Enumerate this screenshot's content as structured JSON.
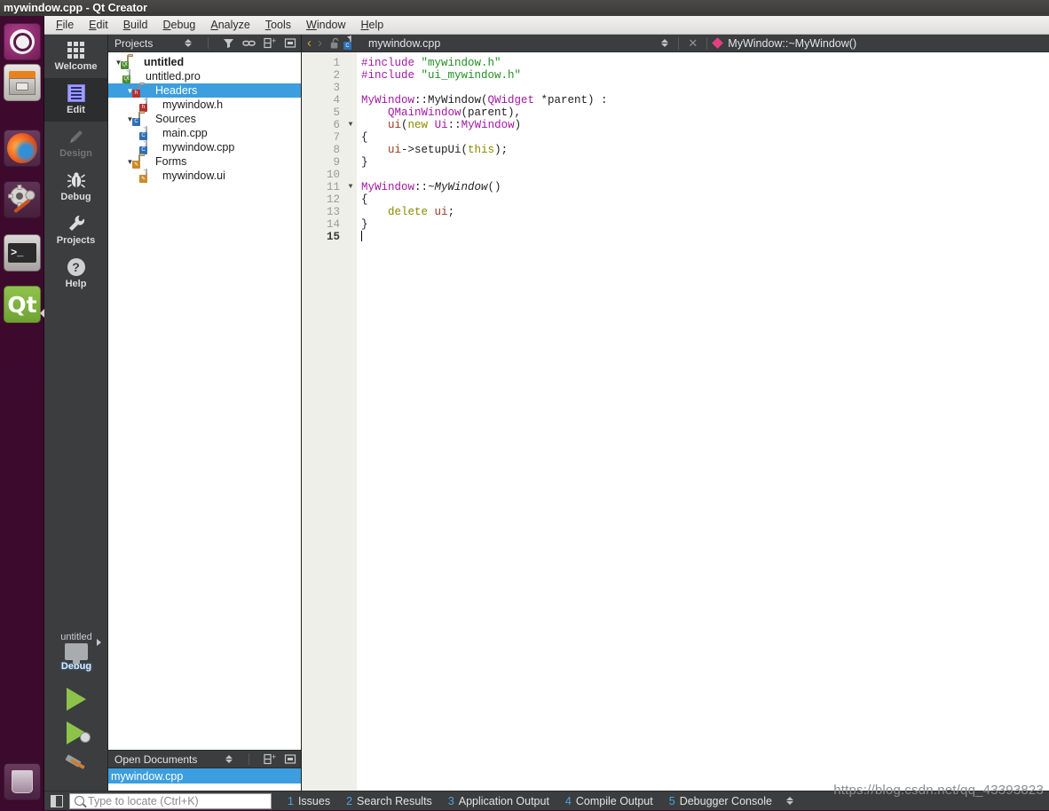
{
  "window": {
    "title": "mywindow.cpp - Qt Creator"
  },
  "menubar": {
    "items": [
      "File",
      "Edit",
      "Build",
      "Debug",
      "Analyze",
      "Tools",
      "Window",
      "Help"
    ]
  },
  "launcher": {
    "items": [
      {
        "name": "ubuntu-dash-icon",
        "label": "Ubuntu"
      },
      {
        "name": "files-icon",
        "label": "Files"
      },
      {
        "name": "firefox-icon",
        "label": "Firefox"
      },
      {
        "name": "settings-icon",
        "label": "System Settings"
      },
      {
        "name": "terminal-icon",
        "label": "Terminal"
      },
      {
        "name": "qt-creator-icon",
        "label": "Qt"
      },
      {
        "name": "trash-icon",
        "label": "Trash"
      }
    ],
    "qt_badge": "Qt",
    "terminal_prompt": ">_"
  },
  "modebar": {
    "modes": [
      {
        "label": "Welcome",
        "icon": "grid-icon",
        "state": "normal"
      },
      {
        "label": "Edit",
        "icon": "document-lines-icon",
        "state": "active"
      },
      {
        "label": "Design",
        "icon": "pencil-icon",
        "state": "disabled"
      },
      {
        "label": "Debug",
        "icon": "bug-icon",
        "state": "normal"
      },
      {
        "label": "Projects",
        "icon": "wrench-icon",
        "state": "normal"
      },
      {
        "label": "Help",
        "icon": "question-circle-icon",
        "state": "normal"
      }
    ],
    "kit": {
      "project": "untitled",
      "configuration": "Debug"
    },
    "actions": [
      {
        "name": "run-button",
        "label": "Run"
      },
      {
        "name": "start-debugging-button",
        "label": "Start Debugging"
      },
      {
        "name": "build-button",
        "label": "Build"
      }
    ]
  },
  "projects_dock": {
    "title": "Projects",
    "toolbar": [
      "view-selector-icon",
      "filter-icon",
      "sync-link-icon",
      "split-add-icon",
      "collapse-icon"
    ],
    "tree": [
      {
        "indent": 0,
        "arrow": "down",
        "icon": "qt-project-folder-icon",
        "label": "untitled",
        "bold": true,
        "selected": false
      },
      {
        "indent": 1,
        "arrow": "none",
        "icon": "qt-pro-file-icon",
        "label": "untitled.pro",
        "bold": false,
        "selected": false
      },
      {
        "indent": 1,
        "arrow": "down",
        "icon": "headers-folder-icon",
        "label": "Headers",
        "bold": false,
        "selected": true
      },
      {
        "indent": 2,
        "arrow": "none",
        "icon": "h-file-icon",
        "label": "mywindow.h",
        "bold": false,
        "selected": false
      },
      {
        "indent": 1,
        "arrow": "down",
        "icon": "sources-folder-icon",
        "label": "Sources",
        "bold": false,
        "selected": false
      },
      {
        "indent": 2,
        "arrow": "none",
        "icon": "cpp-file-icon",
        "label": "main.cpp",
        "bold": false,
        "selected": false
      },
      {
        "indent": 2,
        "arrow": "none",
        "icon": "cpp-file-icon",
        "label": "mywindow.cpp",
        "bold": false,
        "selected": false
      },
      {
        "indent": 1,
        "arrow": "down",
        "icon": "forms-folder-icon",
        "label": "Forms",
        "bold": false,
        "selected": false
      },
      {
        "indent": 2,
        "arrow": "none",
        "icon": "ui-file-icon",
        "label": "mywindow.ui",
        "bold": false,
        "selected": false
      }
    ]
  },
  "open_documents_dock": {
    "title": "Open Documents",
    "toolbar": [
      "view-selector-icon",
      "split-add-icon",
      "collapse-icon"
    ],
    "documents": [
      {
        "label": "mywindow.cpp",
        "selected": true
      }
    ]
  },
  "editor_toolbar": {
    "back_label": "‹",
    "forward_label": "›",
    "lock_state": "unlocked",
    "file_name": "mywindow.cpp",
    "close_label": "✕",
    "symbol": "MyWindow::~MyWindow()"
  },
  "editor": {
    "line_numbers": [
      "1",
      "2",
      "3",
      "4",
      "5",
      "6",
      "7",
      "8",
      "9",
      "10",
      "11",
      "12",
      "13",
      "14",
      "15"
    ],
    "current_line": 15,
    "fold_markers": {
      "6": "down",
      "11": "down"
    },
    "lines": [
      {
        "n": 1,
        "tokens": [
          {
            "t": "#include ",
            "c": "pre"
          },
          {
            "t": "\"mywindow.h\"",
            "c": "str"
          }
        ]
      },
      {
        "n": 2,
        "tokens": [
          {
            "t": "#include ",
            "c": "pre"
          },
          {
            "t": "\"ui_mywindow.h\"",
            "c": "str"
          }
        ]
      },
      {
        "n": 3,
        "tokens": []
      },
      {
        "n": 4,
        "tokens": [
          {
            "t": "MyWindow",
            "c": "type"
          },
          {
            "t": "::MyWindow(",
            "c": "plain"
          },
          {
            "t": "QWidget",
            "c": "type"
          },
          {
            "t": " *parent) :",
            "c": "plain"
          }
        ]
      },
      {
        "n": 5,
        "tokens": [
          {
            "t": "    ",
            "c": "plain"
          },
          {
            "t": "QMainWindow",
            "c": "type"
          },
          {
            "t": "(parent),",
            "c": "plain"
          }
        ]
      },
      {
        "n": 6,
        "tokens": [
          {
            "t": "    ",
            "c": "plain"
          },
          {
            "t": "ui",
            "c": "fld"
          },
          {
            "t": "(",
            "c": "plain"
          },
          {
            "t": "new",
            "c": "kw"
          },
          {
            "t": " ",
            "c": "plain"
          },
          {
            "t": "Ui",
            "c": "type"
          },
          {
            "t": "::",
            "c": "plain"
          },
          {
            "t": "MyWindow",
            "c": "type"
          },
          {
            "t": ")",
            "c": "plain"
          }
        ]
      },
      {
        "n": 7,
        "tokens": [
          {
            "t": "{",
            "c": "plain"
          }
        ]
      },
      {
        "n": 8,
        "tokens": [
          {
            "t": "    ",
            "c": "plain"
          },
          {
            "t": "ui",
            "c": "fld"
          },
          {
            "t": "->setupUi(",
            "c": "plain"
          },
          {
            "t": "this",
            "c": "kw"
          },
          {
            "t": ");",
            "c": "plain"
          }
        ]
      },
      {
        "n": 9,
        "tokens": [
          {
            "t": "}",
            "c": "plain"
          }
        ]
      },
      {
        "n": 10,
        "tokens": []
      },
      {
        "n": 11,
        "tokens": [
          {
            "t": "MyWindow",
            "c": "type"
          },
          {
            "t": "::",
            "c": "plain"
          },
          {
            "t": "~MyWindow",
            "c": "virt"
          },
          {
            "t": "()",
            "c": "plain"
          }
        ]
      },
      {
        "n": 12,
        "tokens": [
          {
            "t": "{",
            "c": "plain"
          }
        ]
      },
      {
        "n": 13,
        "tokens": [
          {
            "t": "    ",
            "c": "plain"
          },
          {
            "t": "delete",
            "c": "kw"
          },
          {
            "t": " ",
            "c": "plain"
          },
          {
            "t": "ui",
            "c": "fld"
          },
          {
            "t": ";",
            "c": "plain"
          }
        ]
      },
      {
        "n": 14,
        "tokens": [
          {
            "t": "}",
            "c": "plain"
          }
        ]
      },
      {
        "n": 15,
        "tokens": [],
        "caret": true
      }
    ]
  },
  "statusbar": {
    "sidebar_toggle": "toggle-sidebar-icon",
    "locator_placeholder": "Type to locate (Ctrl+K)",
    "locator_value": "",
    "panes": [
      {
        "num": "1",
        "label": "Issues"
      },
      {
        "num": "2",
        "label": "Search Results"
      },
      {
        "num": "3",
        "label": "Application Output"
      },
      {
        "num": "4",
        "label": "Compile Output"
      },
      {
        "num": "5",
        "label": "Debugger Console"
      }
    ]
  },
  "watermark": {
    "text": "https://blog.csdn.net/qq_43393823"
  },
  "colors": {
    "selection_blue": "#3c9ede",
    "dark_chrome": "#3b3d3f",
    "accent_yellow": "#d7a32a",
    "symbol_pink": "#e0417f",
    "run_green": "#8dc34a",
    "string_green": "#239023",
    "type_purple": "#a218a2",
    "keyword_olive": "#8a8a00",
    "field_brown": "#9a3b20"
  }
}
